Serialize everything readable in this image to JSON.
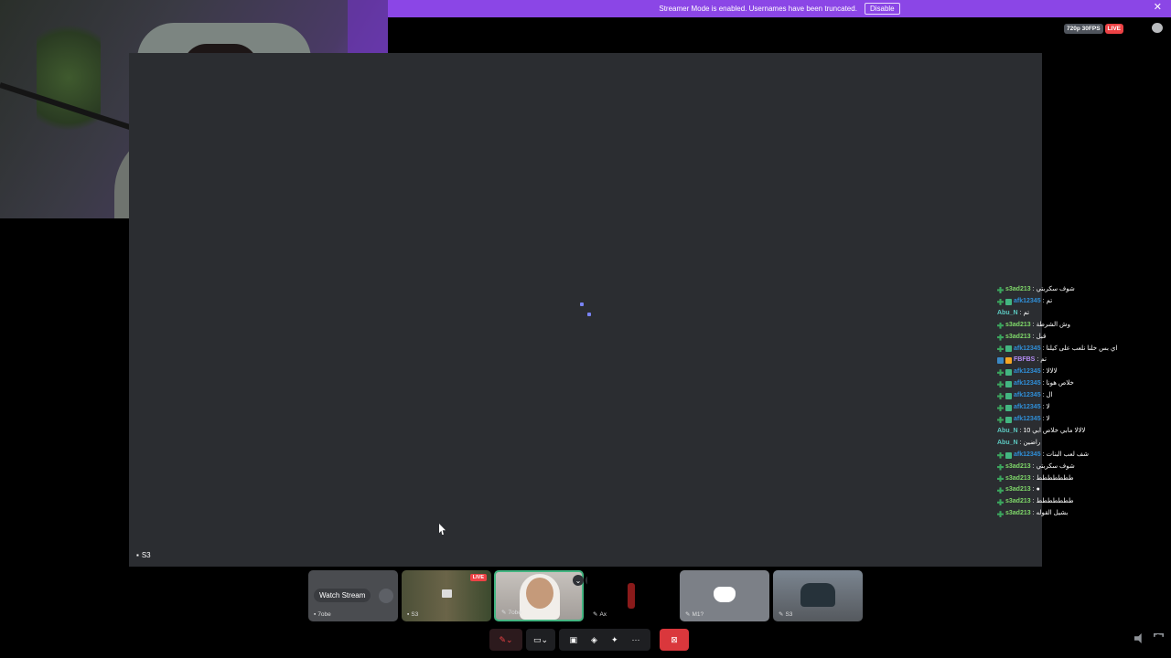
{
  "banner": {
    "text": "Streamer Mode is enabled. Usernames have been truncated.",
    "disable_label": "Disable",
    "close_glyph": "✕"
  },
  "stream": {
    "quality_label": "720p 30FPS",
    "live_label": "LIVE",
    "stage_user": "S3"
  },
  "chat": {
    "lines": [
      {
        "badges": [
          "plus"
        ],
        "user": "s3ad213",
        "message": "شوف سكربتي",
        "user_class": "u-s3"
      },
      {
        "badges": [
          "plus",
          "chat"
        ],
        "user": "afk12345",
        "message": "تم",
        "user_class": "u-afk"
      },
      {
        "badges": [],
        "user": "Abu_N",
        "message": "تم",
        "user_class": "u-abu"
      },
      {
        "badges": [
          "plus"
        ],
        "user": "s3ad213",
        "message": "وش الشرطة",
        "user_class": "u-s3"
      },
      {
        "badges": [
          "plus"
        ],
        "user": "s3ad213",
        "message": "قبل",
        "user_class": "u-s3"
      },
      {
        "badges": [
          "plus",
          "chat"
        ],
        "user": "afk12345",
        "message": "اي بس خلنا نلعب على كيلنا",
        "user_class": "u-afk"
      },
      {
        "badges": [
          "mod",
          "sub"
        ],
        "user": "FBFBS",
        "message": "تم",
        "user_class": "u-fb"
      },
      {
        "badges": [
          "plus",
          "chat"
        ],
        "user": "afk12345",
        "message": "لالالا",
        "user_class": "u-afk"
      },
      {
        "badges": [
          "plus",
          "chat"
        ],
        "user": "afk12345",
        "message": "خلاص هونا",
        "user_class": "u-afk"
      },
      {
        "badges": [
          "plus",
          "chat"
        ],
        "user": "afk12345",
        "message": "ال",
        "user_class": "u-afk"
      },
      {
        "badges": [
          "plus",
          "chat"
        ],
        "user": "afk12345",
        "message": "لا",
        "user_class": "u-afk"
      },
      {
        "badges": [
          "plus",
          "chat"
        ],
        "user": "afk12345",
        "message": "لا",
        "user_class": "u-afk"
      },
      {
        "badges": [],
        "user": "Abu_N",
        "message": "لالالا مابي خلاص ابي 10",
        "user_class": "u-abu"
      },
      {
        "badges": [],
        "user": "Abu_N",
        "message": "راضين",
        "user_class": "u-abu"
      },
      {
        "badges": [
          "plus",
          "chat"
        ],
        "user": "afk12345",
        "message": "شف لعب البنات",
        "user_class": "u-afk"
      },
      {
        "badges": [
          "plus"
        ],
        "user": "s3ad213",
        "message": "شوف سكربتي",
        "user_class": "u-s3"
      },
      {
        "badges": [
          "plus"
        ],
        "user": "s3ad213",
        "message": "ططططططط",
        "user_class": "u-s3"
      },
      {
        "badges": [
          "plus"
        ],
        "user": "s3ad213",
        "message": "●",
        "user_class": "u-s3"
      },
      {
        "badges": [
          "plus"
        ],
        "user": "s3ad213",
        "message": "ططططططط",
        "user_class": "u-s3"
      },
      {
        "badges": [
          "plus"
        ],
        "user": "s3ad213",
        "message": "بشيل القوله",
        "user_class": "u-s3"
      }
    ]
  },
  "tiles": {
    "t1": {
      "watch_label": "Watch Stream",
      "user": "7obe"
    },
    "t2": {
      "live_label": "LIVE",
      "user": "S3"
    },
    "t3": {
      "user": "7obe"
    },
    "t4": {
      "user": "Ax"
    },
    "t5": {
      "user": "M1?"
    },
    "t6": {
      "user": "S3"
    }
  },
  "icons": {
    "chat_glyph": "▪",
    "mic_glyph": "✎",
    "chevron": "⌄",
    "more": "···",
    "leave": "⊠"
  }
}
